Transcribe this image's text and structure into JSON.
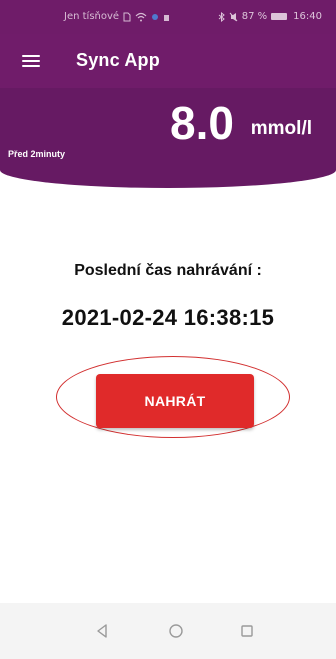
{
  "status_bar": {
    "carrier": "Jen tísňové",
    "battery_percent": "87 %",
    "time": "16:40"
  },
  "app_bar": {
    "title": "Sync App"
  },
  "glucose": {
    "value": "8.0",
    "unit": "mmol/l",
    "time_ago": "Před 2minuty"
  },
  "upload": {
    "label": "Poslední čas nahrávání :",
    "timestamp": "2021-02-24 16:38:15",
    "button_label": "NAHRÁT"
  },
  "nav_bar": {
    "icons": [
      "back-icon",
      "home-icon",
      "recent-apps-icon"
    ]
  },
  "colors": {
    "primary": "#701c6a",
    "button": "#e02a2a",
    "highlight": "#d23030"
  }
}
